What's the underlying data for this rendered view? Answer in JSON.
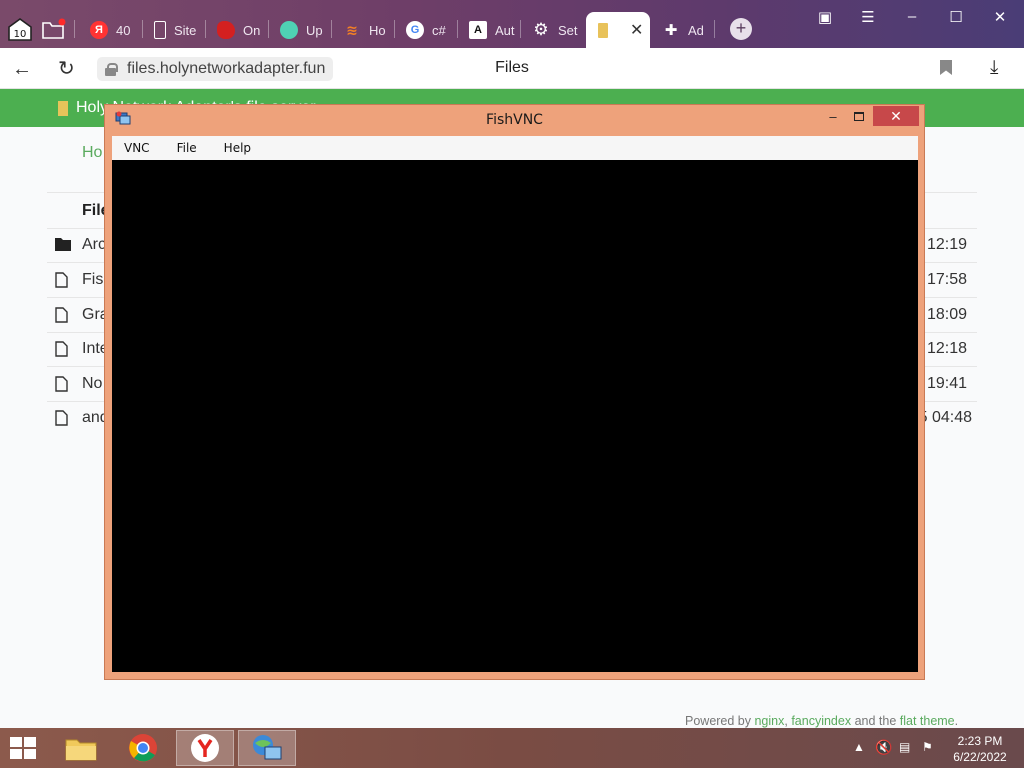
{
  "browser": {
    "tabs": [
      {
        "label": "40",
        "icon": "yandex-icon"
      },
      {
        "label": "Site",
        "icon": "document-icon"
      },
      {
        "label": "On",
        "icon": "red-app-icon"
      },
      {
        "label": "Up",
        "icon": "cloud-icon"
      },
      {
        "label": "Ho",
        "icon": "stackoverflow-icon"
      },
      {
        "label": "c#",
        "icon": "google-icon"
      },
      {
        "label": "Aut",
        "icon": "font-icon"
      },
      {
        "label": "Set",
        "icon": "gear-icon"
      },
      {
        "label": "",
        "icon": "folder-icon",
        "active": true,
        "close": "✕"
      },
      {
        "label": "Ad",
        "icon": "puzzle-icon"
      }
    ],
    "tab_counter": "10",
    "address": {
      "url": "files.holynetworkadapter.fun",
      "page_title": "Files"
    }
  },
  "site": {
    "header_title": "Holy Network Adapter's file server",
    "breadcrumb": "Ho",
    "column_header": "File",
    "rows": [
      {
        "name": "Arc",
        "date": "12:19",
        "type": "folder"
      },
      {
        "name": "Fish",
        "date": "17:58",
        "type": "file"
      },
      {
        "name": "Gra",
        "date": "18:09",
        "type": "file"
      },
      {
        "name": "Inte",
        "date": "12:18",
        "type": "file"
      },
      {
        "name": "No",
        "date": "19:41",
        "type": "file"
      },
      {
        "name": "and",
        "date": "5 04:48",
        "type": "file"
      }
    ],
    "footer": {
      "prefix": "Powered by ",
      "link1": "nginx",
      "sep1": ", ",
      "link2": "fancyindex",
      "mid": " and the ",
      "link3": "flat theme",
      "suffix": "."
    }
  },
  "vnc": {
    "title": "FishVNC",
    "menu": [
      "VNC",
      "File",
      "Help"
    ],
    "controls": {
      "minimize": "–",
      "close": "✕"
    }
  },
  "taskbar": {
    "clock_time": "2:23 PM",
    "clock_date": "6/22/2022"
  },
  "colors": {
    "site_accent": "#4caf50",
    "vnc_frame": "#eea27b",
    "vnc_close": "#c7484a"
  }
}
